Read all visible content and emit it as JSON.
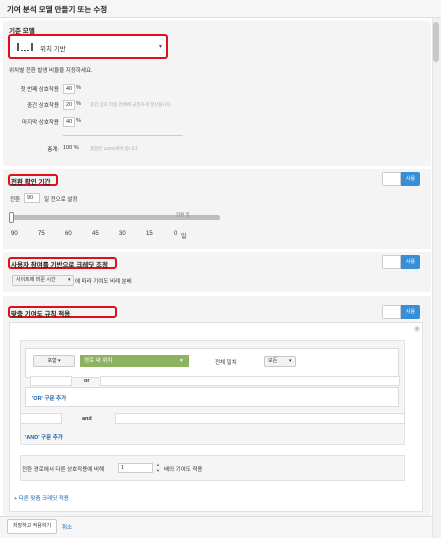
{
  "header": {
    "title": "기여 분석 모델 만들기 또는 수정"
  },
  "base_model": {
    "title": "기준 모델",
    "selected": "위치 기반",
    "description": "위치별 전환 발생 비율을 지정하세요.",
    "rows": [
      {
        "label": "첫 번째 상호작용",
        "value": "40",
        "unit": "%"
      },
      {
        "label": "중간 상호작용",
        "value": "20",
        "unit": "%",
        "hint": "중간 상호 작용 전체에 균등하게 분산됩니다."
      },
      {
        "label": "마지막 상호작용",
        "value": "40",
        "unit": "%"
      }
    ],
    "total_label": "총계:",
    "total_value": "100 %",
    "total_hint": "총합은 100%여야 합니다."
  },
  "lookback": {
    "title": "전환 확인 기간",
    "prefix": "전환",
    "days": "90",
    "suffix": "일 전으로 설정",
    "toggle_label": "사용",
    "slider_tag": "전환 일",
    "ticks": [
      "90",
      "75",
      "60",
      "45",
      "30",
      "15",
      "0"
    ],
    "tick_unit": "일",
    "slider_fraction": 0.0
  },
  "engagement": {
    "title": "사용자 참여를 기반으로 크레딧 조정",
    "select_value": "사이트에 머문 시간",
    "suffix": "에 따라 기여도 비례 분배",
    "toggle_label": "사용"
  },
  "custom_rules": {
    "title": "맞춤 기여도 규칙 적용",
    "toggle_label": "사용",
    "include_value": "포함",
    "dimension_value": "경로 내 위치",
    "match_label": "전체 일치",
    "match_value": "모든",
    "or_label": "or",
    "or_add": "'OR' 구문 추가",
    "and_label": "and",
    "and_add": "'AND' 구문 추가",
    "credit_prefix": "전환 경로에서 다른 상호작용에 비해",
    "credit_value": "1",
    "credit_suffix": "배의 기여도 적용",
    "add_rule": "+ 다른 맞춤 크레딧 적용"
  },
  "footer": {
    "save": "저장하고 적용하기",
    "cancel": "취소"
  },
  "colors": {
    "accent": "#3a8ed6",
    "highlight": "#e0101a",
    "dimension": "#8db360"
  },
  "icons": [
    "bar-chart-icon",
    "chevron-down-icon",
    "close-icon",
    "stepper-icon"
  ]
}
